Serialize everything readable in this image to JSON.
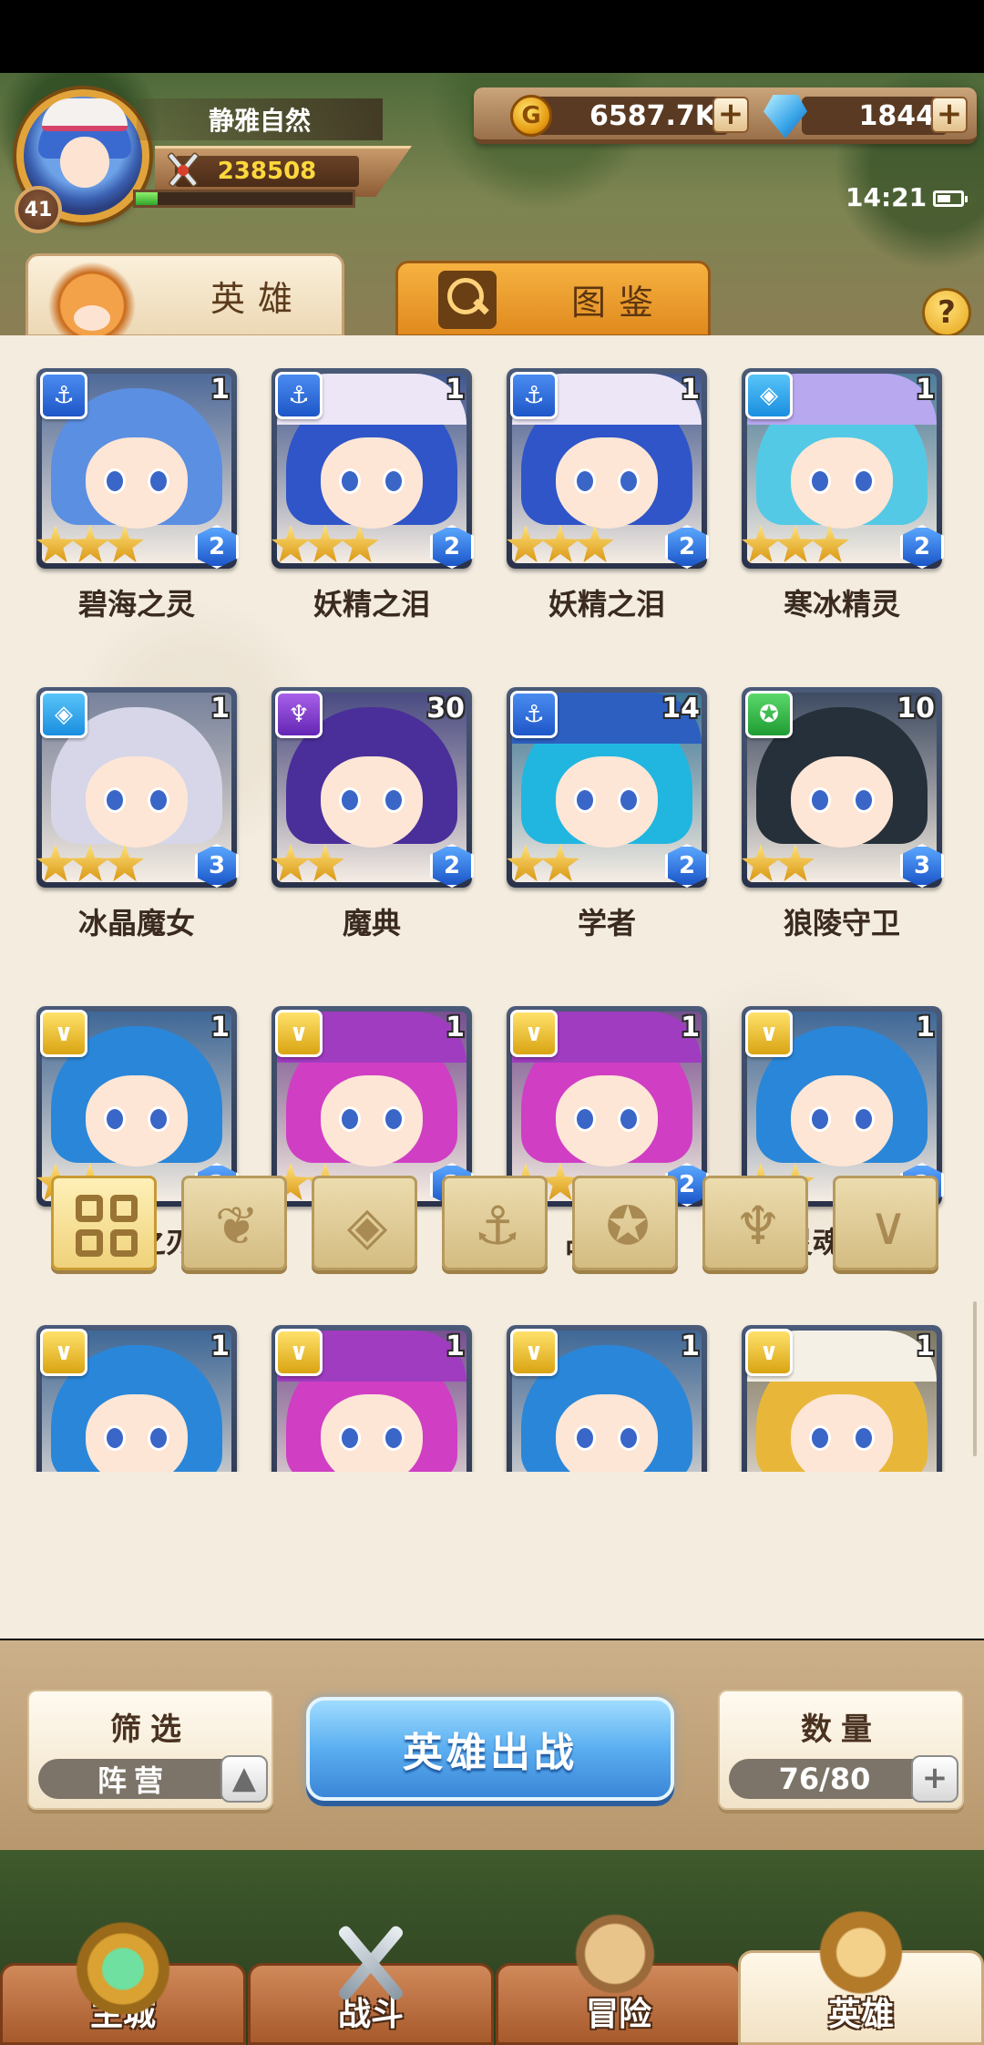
{
  "player": {
    "name": "静雅自然",
    "level": "41",
    "power": "238508",
    "exp_progress": 0.1
  },
  "resources": {
    "gold": "6587.7K",
    "gems": "1844",
    "plus_label": "+"
  },
  "status": {
    "time": "14:21"
  },
  "tabs": {
    "heroes": "英雄",
    "codex": "图鉴",
    "help": "?"
  },
  "heroes": [
    {
      "name": "碧海之灵",
      "level": "1",
      "stars": 3,
      "rank": "2",
      "faction": "anchor-icon",
      "hair": "#5b8fe2",
      "hat": ""
    },
    {
      "name": "妖精之泪",
      "level": "1",
      "stars": 3,
      "rank": "2",
      "faction": "anchor-icon",
      "hair": "#2f55c8",
      "hat": "#ece6f7"
    },
    {
      "name": "妖精之泪",
      "level": "1",
      "stars": 3,
      "rank": "2",
      "faction": "anchor-icon",
      "hair": "#2f55c8",
      "hat": "#ece6f7"
    },
    {
      "name": "寒冰精灵",
      "level": "1",
      "stars": 3,
      "rank": "2",
      "faction": "crystal-icon",
      "hair": "#54c9e6",
      "hat": "#b8a8f0"
    },
    {
      "name": "冰晶魔女",
      "level": "1",
      "stars": 3,
      "rank": "3",
      "faction": "crystal-icon",
      "hair": "#d6d6e8",
      "hat": ""
    },
    {
      "name": "魔典",
      "level": "30",
      "stars": 2,
      "rank": "2",
      "faction": "demon-icon",
      "hair": "#4a2f9a",
      "hat": ""
    },
    {
      "name": "学者",
      "level": "14",
      "stars": 2,
      "rank": "2",
      "faction": "anchor-icon",
      "hair": "#21b6e0",
      "hat": "#2d5fc0"
    },
    {
      "name": "狼陵守卫",
      "level": "10",
      "stars": 2,
      "rank": "3",
      "faction": "beast-icon",
      "hair": "#26303a",
      "hat": ""
    },
    {
      "name": "灵魂之刃",
      "level": "1",
      "stars": 2,
      "rank": "2",
      "faction": "holy-icon",
      "hair": "#2a86d8",
      "hat": ""
    },
    {
      "name": "占星师",
      "level": "1",
      "stars": 2,
      "rank": "2",
      "faction": "holy-icon",
      "hair": "#d03ec4",
      "hat": "#a03cc0"
    },
    {
      "name": "占星师",
      "level": "1",
      "stars": 2,
      "rank": "2",
      "faction": "holy-icon",
      "hair": "#d03ec4",
      "hat": "#a03cc0"
    },
    {
      "name": "灵魂之刃",
      "level": "1",
      "stars": 2,
      "rank": "2",
      "faction": "holy-icon",
      "hair": "#2a86d8",
      "hat": ""
    },
    {
      "name": "",
      "level": "1",
      "stars": 0,
      "rank": "",
      "faction": "holy-icon",
      "hair": "#2a86d8",
      "hat": ""
    },
    {
      "name": "",
      "level": "1",
      "stars": 0,
      "rank": "",
      "faction": "holy-icon",
      "hair": "#d03ec4",
      "hat": "#a03cc0"
    },
    {
      "name": "",
      "level": "1",
      "stars": 0,
      "rank": "",
      "faction": "holy-icon",
      "hair": "#2a86d8",
      "hat": ""
    },
    {
      "name": "",
      "level": "1",
      "stars": 0,
      "rank": "",
      "faction": "holy-icon",
      "hair": "#e8b73a",
      "hat": "#f4f0e6"
    }
  ],
  "faction_filters": [
    "all-grid-icon",
    "nature-icon",
    "crystal-icon",
    "anchor-icon",
    "beast-icon",
    "demon-icon",
    "holy-icon"
  ],
  "actions": {
    "filter_title": "筛选",
    "filter_value": "阵营",
    "deploy_label": "英雄出战",
    "count_title": "数量",
    "count_value": "76/80",
    "arrow_up": "▲",
    "plus": "+"
  },
  "nav": {
    "castle": "主城",
    "battle": "战斗",
    "adventure": "冒险",
    "heroes": "英雄"
  },
  "colors": {
    "deploy_button": "#5aaef0",
    "panel_bg": "#f3ecdf"
  }
}
